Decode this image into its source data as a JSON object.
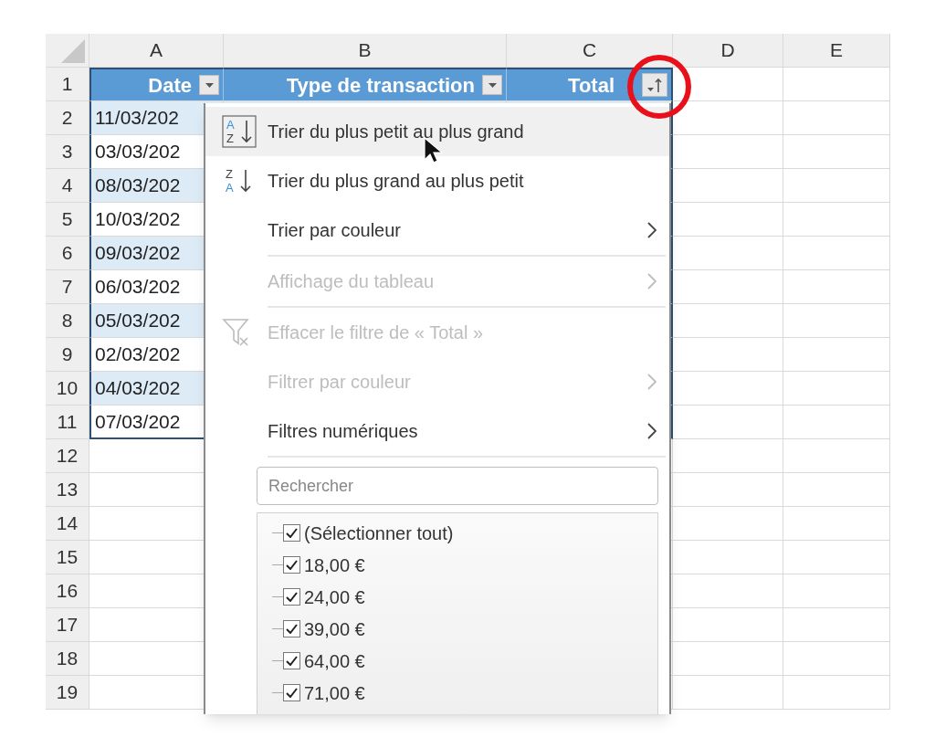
{
  "column_headers": [
    "A",
    "B",
    "C",
    "D",
    "E"
  ],
  "table_header": {
    "row_number": "1",
    "cells": [
      {
        "text": "Date",
        "kind": "dropdown"
      },
      {
        "text": "Type de transaction",
        "kind": "dropdown"
      },
      {
        "text": "Total",
        "kind": "sort_filter"
      }
    ]
  },
  "rows": [
    {
      "number": "2",
      "date": "11/03/202",
      "banded": true
    },
    {
      "number": "3",
      "date": "03/03/202",
      "banded": false
    },
    {
      "number": "4",
      "date": "08/03/202",
      "banded": true
    },
    {
      "number": "5",
      "date": "10/03/202",
      "banded": false
    },
    {
      "number": "6",
      "date": "09/03/202",
      "banded": true
    },
    {
      "number": "7",
      "date": "06/03/202",
      "banded": false
    },
    {
      "number": "8",
      "date": "05/03/202",
      "banded": true
    },
    {
      "number": "9",
      "date": "02/03/202",
      "banded": false
    },
    {
      "number": "10",
      "date": "04/03/202",
      "banded": true
    },
    {
      "number": "11",
      "date": "07/03/202",
      "banded": false
    }
  ],
  "empty_rows": [
    "12",
    "13",
    "14",
    "15",
    "16",
    "17",
    "18",
    "19"
  ],
  "filter_menu": {
    "items": [
      {
        "kind": "sort_asc",
        "icon_letters": [
          "A",
          "Z"
        ],
        "label": "Trier du plus petit au plus grand",
        "disabled": false,
        "selected": true,
        "separator_after": false
      },
      {
        "kind": "sort_desc",
        "icon_letters": [
          "Z",
          "A"
        ],
        "label": "Trier du plus grand au plus petit",
        "disabled": false,
        "selected": false,
        "separator_after": false
      },
      {
        "kind": "submenu",
        "label": "Trier par couleur",
        "disabled": false,
        "selected": false,
        "separator_after": true
      },
      {
        "kind": "submenu",
        "label": "Affichage du tableau",
        "disabled": true,
        "selected": false,
        "separator_after": true
      },
      {
        "kind": "clear_filter",
        "label": "Effacer le filtre de « Total »",
        "disabled": true,
        "selected": false,
        "separator_after": false
      },
      {
        "kind": "submenu",
        "label": "Filtrer par couleur",
        "disabled": true,
        "selected": false,
        "separator_after": false
      },
      {
        "kind": "submenu",
        "label": "Filtres numériques",
        "disabled": false,
        "selected": false,
        "separator_after": true
      }
    ],
    "search": {
      "placeholder": "Rechercher"
    },
    "values": [
      {
        "label": "(Sélectionner tout)",
        "checked": true
      },
      {
        "label": "18,00 €",
        "checked": true
      },
      {
        "label": "24,00 €",
        "checked": true
      },
      {
        "label": "39,00 €",
        "checked": true
      },
      {
        "label": "64,00 €",
        "checked": true
      },
      {
        "label": "71,00 €",
        "checked": true
      }
    ]
  }
}
